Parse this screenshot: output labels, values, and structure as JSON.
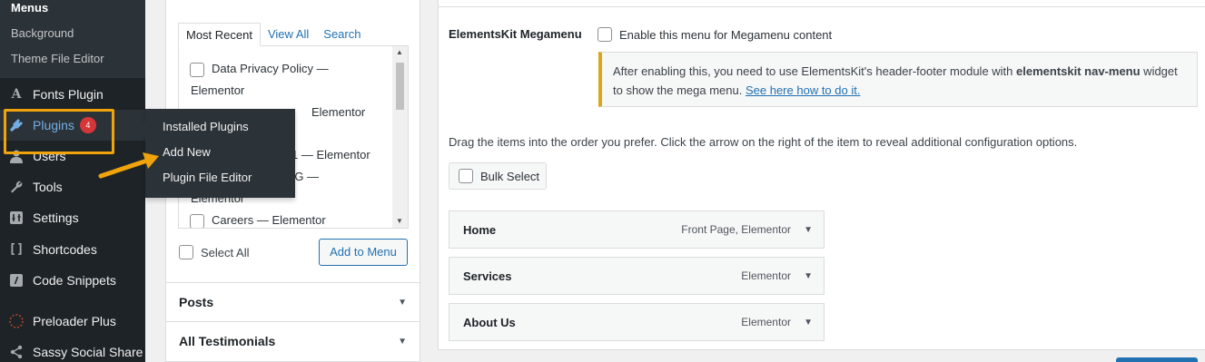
{
  "sidebar": {
    "submenu": [
      "Menus",
      "Background",
      "Theme File Editor"
    ],
    "items": [
      {
        "label": "Fonts Plugin",
        "icon": "fonts-icon"
      },
      {
        "label": "Plugins",
        "icon": "plugin-icon",
        "badge": "4"
      },
      {
        "label": "Users",
        "icon": "users-icon"
      },
      {
        "label": "Tools",
        "icon": "wrench-icon"
      },
      {
        "label": "Settings",
        "icon": "settings-icon"
      },
      {
        "label": "Shortcodes",
        "icon": "brackets-icon"
      },
      {
        "label": "Code Snippets",
        "icon": "code-icon"
      },
      {
        "label": "Preloader Plus",
        "icon": "spinner-icon"
      },
      {
        "label": "Sassy Social Share",
        "icon": "share-icon"
      }
    ],
    "flyout": [
      "Installed Plugins",
      "Add New",
      "Plugin File Editor"
    ]
  },
  "add_items": {
    "tabs": [
      "Most Recent",
      "View All",
      "Search"
    ],
    "pages": [
      "Data Privacy Policy —",
      "Elementor",
      "Elementor",
      "1 — Elementor",
      "NG —",
      "Elementor",
      "Careers — Elementor"
    ],
    "select_all": "Select All",
    "add_button": "Add to Menu",
    "sections": [
      "Posts",
      "All Testimonials"
    ]
  },
  "menu_settings": {
    "ek_label": "ElementsKit Megamenu",
    "ek_checkbox": "Enable this menu for Megamenu content",
    "notice_pre": "After enabling this, you need to use ElementsKit's header-footer module with ",
    "notice_bold": "elementskit nav-menu",
    "notice_mid": " widget to show the mega menu. ",
    "notice_link": "See here how to do it.",
    "drag_text": "Drag the items into the order you prefer. Click the arrow on the right of the item to reveal additional configuration options.",
    "bulk_select": "Bulk Select",
    "menu_items": [
      {
        "title": "Home",
        "meta": "Front Page, Elementor"
      },
      {
        "title": "Services",
        "meta": "Elementor"
      },
      {
        "title": "About Us",
        "meta": "Elementor"
      }
    ]
  },
  "colors": {
    "sidebar_bg": "#1d2327",
    "accent": "#2271b1",
    "highlight": "#f0a30a",
    "badge": "#d63638"
  }
}
